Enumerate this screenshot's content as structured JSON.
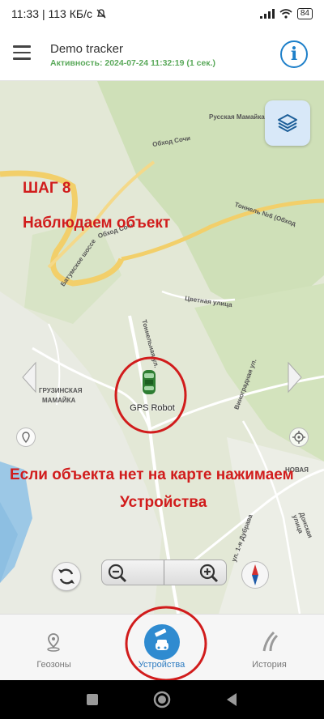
{
  "status_bar": {
    "time": "11:33",
    "net_speed": "| 113 КБ/с",
    "battery": "84"
  },
  "header": {
    "title": "Demo tracker",
    "activity": "Активность: 2024-07-24 11:32:19 (1 сек.)"
  },
  "map": {
    "labels": {
      "russkaya_mamayka": "Русская Мамайка",
      "obkhod_sochi_1": "Обход Сочи",
      "obkhod_sochi_2": "Обход Сочи",
      "tunnel": "Тоннель №6 (Обход",
      "batumskoe": "Батумское шоссе",
      "tsvetnaya": "Цветная улица",
      "gruzinskaya_1": "ГРУЗИНСКАЯ",
      "gruzinskaya_2": "МАМАЙКА",
      "vinogradnaya": "Виноградная ул.",
      "tonnelnaya": "Тоннельная ул.",
      "novaya": "НОВАЯ",
      "dubrava": "ул. 1-я Дубрава",
      "donskaya": "Донская улица"
    },
    "overlay": {
      "step": "ШАГ 8",
      "observe": "Наблюдаем объект",
      "hint_line1": "Если объекта нет на карте нажимаем",
      "hint_line2": "Устройства"
    },
    "marker_label": "GPS Robot"
  },
  "bottom_nav": {
    "geozones": "Геозоны",
    "devices": "Устройства",
    "history": "История"
  },
  "colors": {
    "accent": "#2f8bd0",
    "activity_green": "#5aa95a",
    "annotation_red": "#d11c1c"
  },
  "icons": {
    "menu": "menu-icon",
    "info": "info-icon",
    "layers": "layers-icon",
    "refresh": "refresh-icon",
    "zoom_out": "zoom-out-icon",
    "zoom_in": "zoom-in-icon",
    "compass": "compass-icon",
    "geozones": "map-pin-icon",
    "devices": "car-satellite-icon",
    "history": "road-icon"
  }
}
